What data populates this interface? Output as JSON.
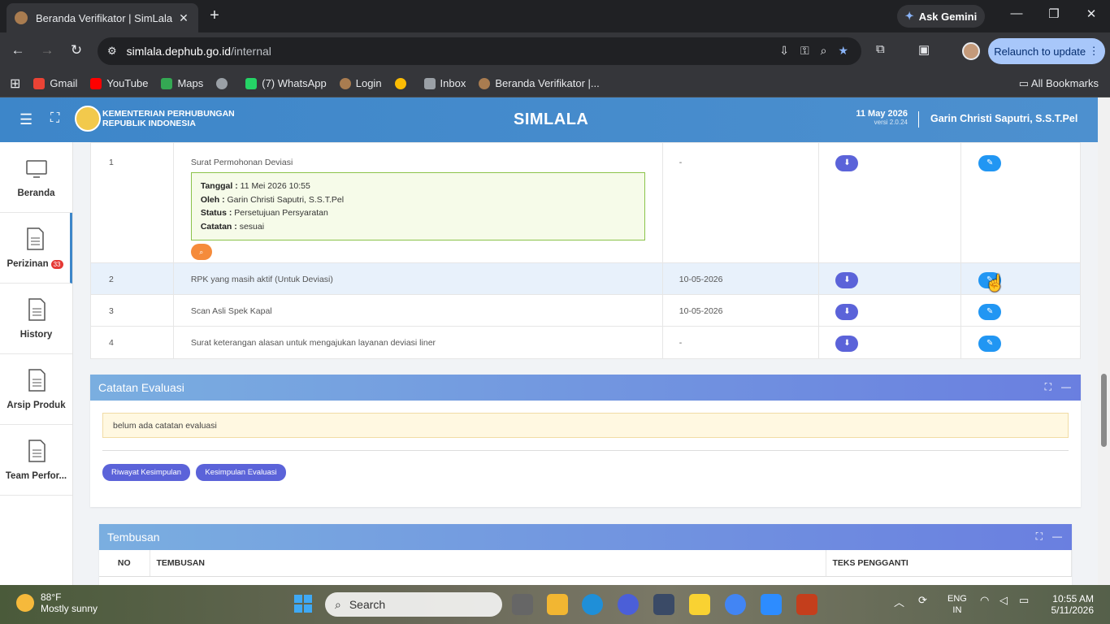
{
  "browser": {
    "tab_title": "Beranda Verifikator | SimLala",
    "new_tab_symbol": "+",
    "ask_gemini": "Ask Gemini",
    "url_host": "simlala.dephub.go.id",
    "url_path": "/internal",
    "relaunch_label": "Relaunch to update",
    "bookmarks": [
      {
        "label": "Gmail",
        "color": "#ea4335"
      },
      {
        "label": "YouTube",
        "color": "#ff0000"
      },
      {
        "label": "Maps",
        "color": "#34a853"
      },
      {
        "label": "",
        "color": "#9aa0a6"
      },
      {
        "label": "(7) WhatsApp",
        "color": "#25d366"
      },
      {
        "label": "Login",
        "color": "#a97c50"
      },
      {
        "label": "",
        "color": "#fbbc04"
      },
      {
        "label": "Inbox",
        "color": "#9aa0a6"
      },
      {
        "label": "Beranda Verifikator |...",
        "color": "#a97c50"
      }
    ],
    "all_bookmarks": "All Bookmarks"
  },
  "header": {
    "ministry_line1": "KEMENTERIAN PERHUBUNGAN",
    "ministry_line2": "REPUBLIK INDONESIA",
    "app_name": "SIMLALA",
    "date": "11 May 2026",
    "version": "versi 2.0.24",
    "user": "Garin Christi Saputri, S.S.T.Pel"
  },
  "sidebar": {
    "items": [
      {
        "label": "Beranda",
        "icon": "monitor-icon"
      },
      {
        "label": "Perizinan",
        "icon": "document-icon",
        "badge": "33"
      },
      {
        "label": "History",
        "icon": "document-icon"
      },
      {
        "label": "Arsip Produk",
        "icon": "document-icon"
      },
      {
        "label": "Team Perfor...",
        "icon": "document-icon"
      }
    ]
  },
  "documents": {
    "rows": [
      {
        "no": "1",
        "name": "Surat Permohonan Deviasi",
        "date": "-",
        "info": {
          "tanggal_label": "Tanggal :",
          "tanggal": "11 Mei 2026 10:55",
          "oleh_label": "Oleh :",
          "oleh": "Garin Christi Saputri, S.S.T.Pel",
          "status_label": "Status :",
          "status": "Persetujuan Persyaratan",
          "catatan_label": "Catatan :",
          "catatan": "sesuai"
        }
      },
      {
        "no": "2",
        "name": "RPK yang masih aktif (Untuk Deviasi)",
        "date": "10-05-2026"
      },
      {
        "no": "3",
        "name": "Scan Asli Spek Kapal",
        "date": "10-05-2026"
      },
      {
        "no": "4",
        "name": "Surat keterangan alasan untuk mengajukan layanan deviasi liner",
        "date": "-"
      }
    ]
  },
  "evaluation": {
    "title": "Catatan Evaluasi",
    "note": "belum ada catatan evaluasi",
    "btn_riwayat": "Riwayat Kesimpulan",
    "btn_kesimpulan": "Kesimpulan Evaluasi"
  },
  "tembusan": {
    "title": "Tembusan",
    "columns": [
      "NO",
      "TEMBUSAN",
      "TEKS PENGGANTI"
    ]
  },
  "taskbar": {
    "temperature": "88°F",
    "weather": "Mostly sunny",
    "search_placeholder": "Search",
    "lang_1": "ENG",
    "lang_2": "IN",
    "time": "10:55 AM",
    "date": "5/11/2026"
  }
}
